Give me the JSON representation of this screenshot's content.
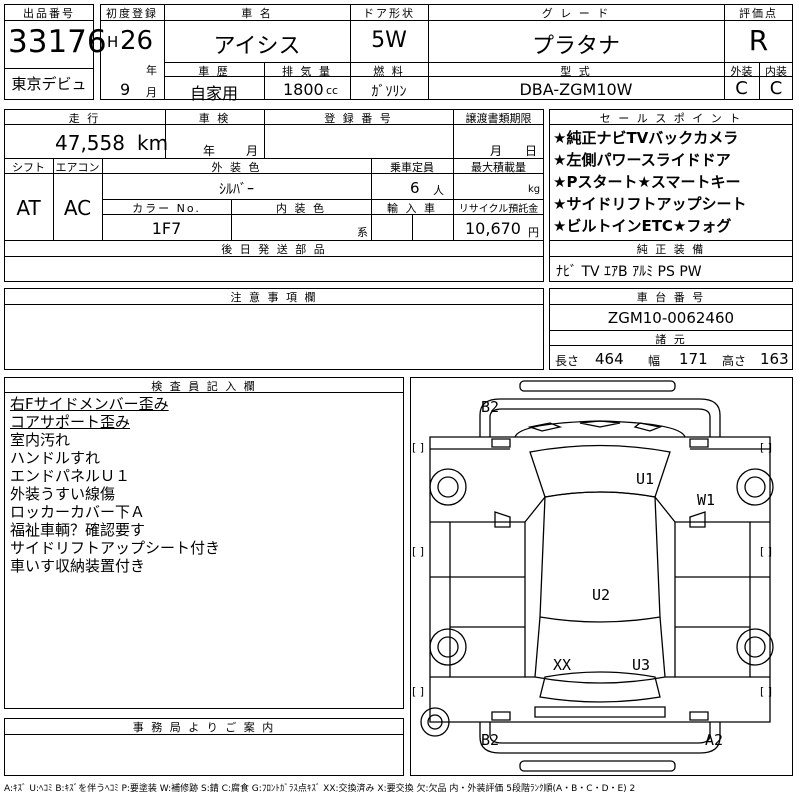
{
  "header": {
    "lot_number_label": "出品番号",
    "lot_number": "33176",
    "venue": "東京デビュ",
    "first_reg_label": "初度登録",
    "era": "H",
    "year": "26",
    "year_unit": "年",
    "month": "9",
    "month_unit": "月",
    "car_name_label": "車 名",
    "car_name": "アイシス",
    "door_label": "ドア形状",
    "door": "5W",
    "grade_label": "グ レ ー ド",
    "grade": "プラタナ",
    "score_label": "評価点",
    "score": "R",
    "history_label": "車 歴",
    "history": "自家用",
    "displacement_label": "排 気 量",
    "displacement": "1800",
    "displacement_unit": "cc",
    "fuel_label": "燃 料",
    "fuel": "ｶﾞｿﾘﾝ",
    "model_code_label": "型 式",
    "model_code": "DBA-ZGM10W",
    "exterior_label": "外装",
    "exterior_grade": "C",
    "interior_label": "内装",
    "interior_grade": "C"
  },
  "info": {
    "mileage_label": "走 行",
    "mileage": "47,558",
    "mileage_unit": "km",
    "inspection_label": "車 検",
    "inspection_year_unit": "年",
    "inspection_month_unit": "月",
    "plate_label": "登 録 番 号",
    "transfer_label": "譲渡書類期限",
    "transfer_month_unit": "月",
    "transfer_day_unit": "日",
    "shift_label": "シフト",
    "shift": "AT",
    "ac_label": "エアコン",
    "ac": "AC",
    "color_label": "外 装 色",
    "color": "ｼﾙﾊﾞｰ",
    "capacity_label": "乗車定員",
    "capacity": "6",
    "capacity_unit": "人",
    "load_label": "最大積載量",
    "load_unit": "kg",
    "color_no_label": "カラー No.",
    "color_no": "1F7",
    "interior_color_label": "内 装 色",
    "interior_color_unit": "系",
    "import_label": "輸 入 車",
    "recycle_label": "リサイクル預託金",
    "recycle": "10,670",
    "recycle_unit": "円",
    "later_parts_label": "後 日 発 送 部 品"
  },
  "sales_points": {
    "label": "セ ー ル ス ポ イ ン ト",
    "items": [
      "★純正ナビTVバックカメラ",
      "★左側パワースライドドア",
      "★Pスタート★スマートキー",
      "★サイドリフトアップシート",
      "★ビルトインETC★フォグ"
    ]
  },
  "equipment": {
    "label": "純 正 装 備",
    "value": "ﾅﾋﾞ TV ｴｱB ｱﾙﾐ PS PW"
  },
  "notes": {
    "label": "注 意 事 項 欄"
  },
  "chassis": {
    "label": "車 台 番 号",
    "number": "ZGM10-0062460",
    "dims_label": "諸 元",
    "length_label": "長さ",
    "length": "464",
    "width_label": "幅",
    "width": "171",
    "height_label": "高さ",
    "height": "163"
  },
  "inspector": {
    "label": "検 査 員 記 入 欄",
    "remarks": [
      "右Fサイドメンバー歪み",
      "コアサポート歪み",
      "室内汚れ",
      "ハンドルすれ",
      "エンドパネルＵ１",
      "外装うすい線傷",
      "ロッカーカバー下Ａ",
      "福祉車輌？確認要す",
      "サイドリフトアップシート付き",
      "車いす収納装置付き"
    ]
  },
  "diagram": {
    "marks": [
      "B2",
      "U1",
      "W1",
      "U2",
      "XX",
      "U3",
      "B2",
      "A2"
    ],
    "bracket": "[ ]"
  },
  "office": {
    "label": "事 務 局 よ り ご 案 内"
  },
  "legend": "A:ｷｽﾞ U:ﾍｺﾐ B:ｷｽﾞを伴うﾍｺﾐ P:要塗装 W:補修跡 S:錆 C:腐食 G:ﾌﾛﾝﾄｶﾞﾗｽ点ｷｽﾞ XX:交換済み X:要交換 欠:欠品 内・外装評価 5段階ﾗﾝｸ順(A・B・C・D・E) 2"
}
